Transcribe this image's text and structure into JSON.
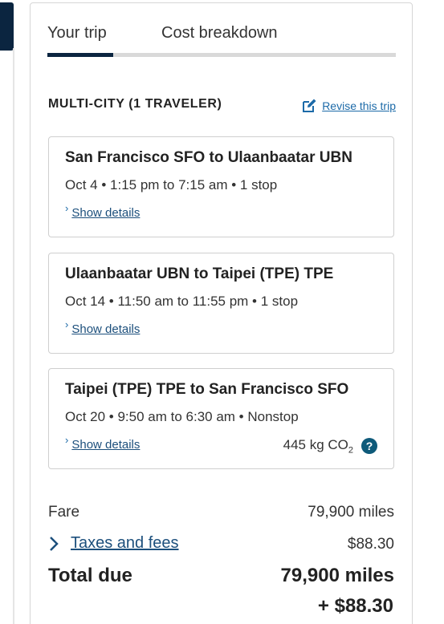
{
  "tabs": [
    {
      "label": "Your trip",
      "active": true
    },
    {
      "label": "Cost breakdown",
      "active": false
    }
  ],
  "trip": {
    "title": "MULTI-CITY (1 TRAVELER)",
    "revise_label": "Revise this trip",
    "revise_icon": "edit-icon"
  },
  "flights": [
    {
      "route": "San Francisco SFO to Ulaanbaatar UBN",
      "info": "Oct 4 • 1:15 pm to 7:15 am • 1 stop",
      "details_label": "Show details"
    },
    {
      "route": "Ulaanbaatar UBN to Taipei (TPE) TPE",
      "info": "Oct 14 • 11:50 am to 11:55 pm • 1 stop",
      "details_label": "Show details"
    },
    {
      "route": "Taipei (TPE) TPE to San Francisco SFO",
      "info": "Oct 20 • 9:50 am to 6:30 am • Nonstop",
      "details_label": "Show details",
      "co2_value": "445 kg CO",
      "co2_sub": "2",
      "help_label": "?"
    }
  ],
  "fare": {
    "label": "Fare",
    "value": "79,900 miles"
  },
  "taxes": {
    "label": "Taxes and fees",
    "value": "$88.30"
  },
  "total": {
    "label": "Total due",
    "miles": "79,900 miles",
    "cash": "+ $88.30"
  },
  "colors": {
    "navy": "#0b2540",
    "link": "#1c4f7c",
    "help": "#0e5a7a"
  }
}
